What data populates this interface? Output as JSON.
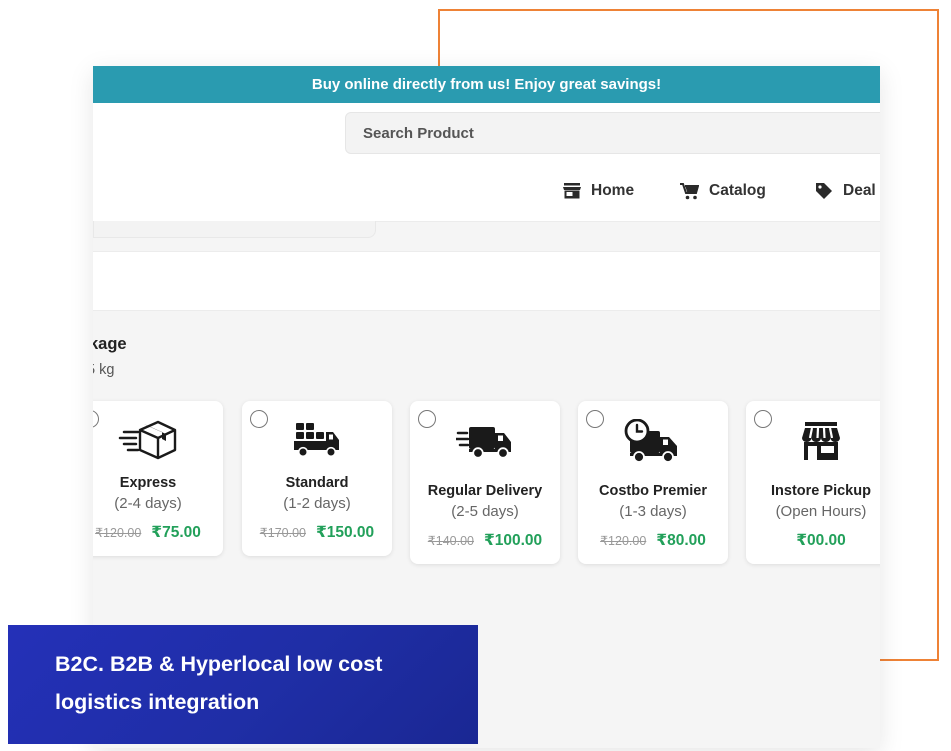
{
  "promo": {
    "text": "Buy online directly from us! Enjoy great savings!"
  },
  "search": {
    "placeholder": "Search Product"
  },
  "nav": {
    "items": [
      {
        "label": "Home",
        "icon": "store-icon"
      },
      {
        "label": "Catalog",
        "icon": "cart-icon"
      },
      {
        "label": "Deal",
        "icon": "tag-icon"
      }
    ]
  },
  "section": {
    "title": "kage",
    "subtitle": "5 kg"
  },
  "delivery_options": [
    {
      "name": "Express",
      "duration": "(2-4 days)",
      "old_price": "₹120.00",
      "price": "₹75.00",
      "icon": "fast-box-icon"
    },
    {
      "name": "Standard",
      "duration": "(1-2 days)",
      "old_price": "₹170.00",
      "price": "₹150.00",
      "icon": "loaded-truck-icon"
    },
    {
      "name": "Regular Delivery",
      "duration": "(2-5 days)",
      "old_price": "₹140.00",
      "price": "₹100.00",
      "icon": "fast-truck-icon"
    },
    {
      "name": "Costbo Premier",
      "duration": "(1-3 days)",
      "old_price": "₹120.00",
      "price": "₹80.00",
      "icon": "clock-truck-icon"
    },
    {
      "name": "Instore Pickup",
      "duration": "(Open Hours)",
      "old_price": "",
      "price": "₹00.00",
      "icon": "storefront-icon"
    }
  ],
  "caption": {
    "line1": "B2C. B2B & Hyperlocal low cost",
    "line2": "logistics integration"
  },
  "colors": {
    "promo_bar": "#2a9bb0",
    "accent_frame": "#ee8236",
    "price_green": "#22a05a",
    "caption_bg": "#2430b8"
  }
}
